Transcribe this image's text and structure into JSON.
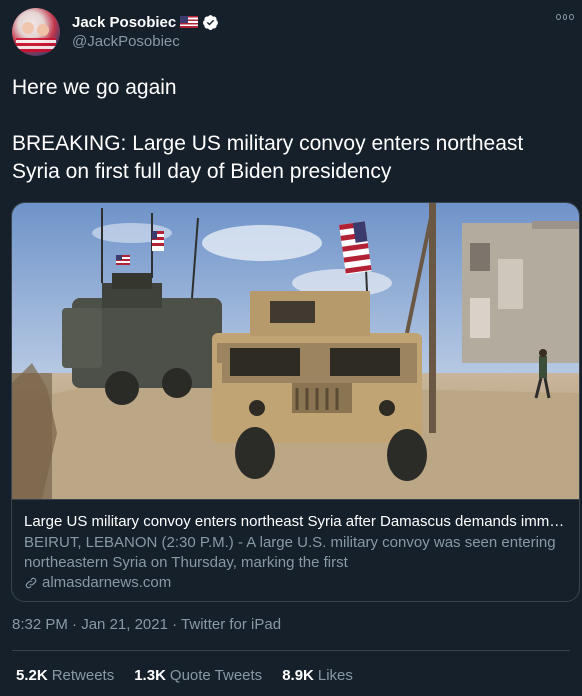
{
  "author": {
    "name": "Jack Posobiec",
    "handle": "@JackPosobiec",
    "avatar_icon": "profile-photo",
    "name_icons": [
      "us-flag-icon",
      "verified-badge-icon"
    ]
  },
  "tweet": {
    "line1": "Here we go again",
    "line2": "BREAKING: Large US military convoy enters northeast Syria on first full day of Biden presidency"
  },
  "card": {
    "title": "Large US military convoy enters northeast Syria after Damascus demands immed...",
    "description": "BEIRUT, LEBANON (2:30 P.M.) - A large U.S. military convoy was seen entering northeastern Syria on Thursday, marking the first",
    "source": "almasdarnews.com"
  },
  "meta": {
    "time": "8:32 PM",
    "date": "Jan 21, 2021",
    "client": "Twitter for iPad",
    "separator": " · "
  },
  "stats": {
    "retweets_count": "5.2K",
    "retweets_label": "Retweets",
    "quotes_count": "1.3K",
    "quotes_label": "Quote Tweets",
    "likes_count": "8.9K",
    "likes_label": "Likes"
  },
  "colors": {
    "background": "#15202b",
    "text_primary": "#ffffff",
    "text_secondary": "#8899a6",
    "border": "#38444d",
    "verified_blue": "#1da1f2"
  }
}
